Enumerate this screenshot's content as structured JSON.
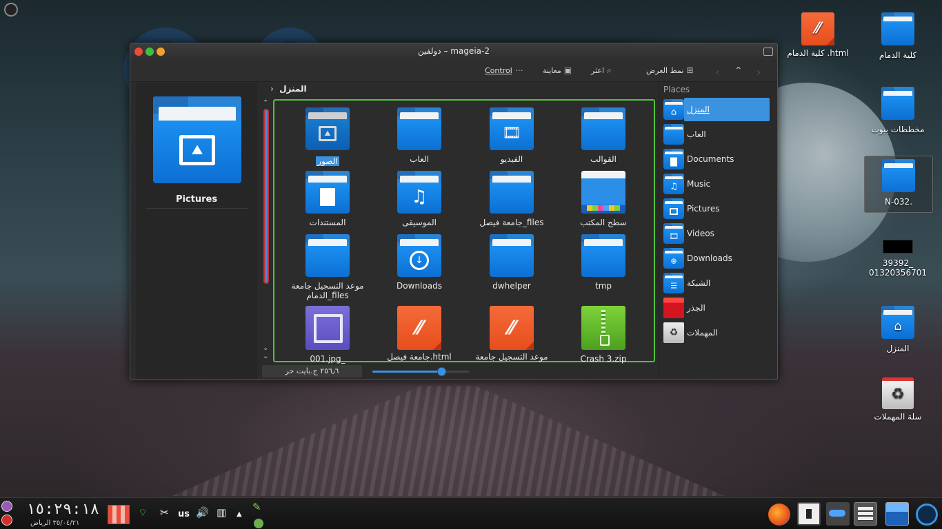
{
  "window": {
    "title": "دولفين – mageia-2"
  },
  "toolbar": {
    "control": "Control",
    "preview": "معاينة",
    "find": "اعثر",
    "view_mode": "نمط العرض"
  },
  "breadcrumb": "المنزل",
  "preview_pane": {
    "name": "Pictures"
  },
  "items": [
    {
      "label": "الصور",
      "kind": "folder-pictures",
      "selected": true
    },
    {
      "label": "العاب",
      "kind": "folder"
    },
    {
      "label": "الفيديو",
      "kind": "folder-videos"
    },
    {
      "label": "القوالب",
      "kind": "folder"
    },
    {
      "label": "المستندات",
      "kind": "folder-documents"
    },
    {
      "label": "الموسيقى",
      "kind": "folder-music"
    },
    {
      "label": "جامعة فيصل_files",
      "kind": "folder"
    },
    {
      "label": "سطح المكتب",
      "kind": "desktop"
    },
    {
      "label": "موعد التسجيل جامعة الدمام_files",
      "kind": "folder"
    },
    {
      "label": "Downloads",
      "kind": "folder-downloads"
    },
    {
      "label": "dwhelper",
      "kind": "folder"
    },
    {
      "label": "tmp",
      "kind": "folder"
    },
    {
      "label": "001.jpg_",
      "kind": "image"
    },
    {
      "label": "جامعة فيصل.html",
      "kind": "html"
    },
    {
      "label": "موعد التسجيل جامعة",
      "kind": "html"
    },
    {
      "label": "Crash 3.zip",
      "kind": "zip"
    }
  ],
  "status": {
    "free_space": "٢٥٦٫٦ ج.بايت حر",
    "zoom_level": 0.72
  },
  "places": {
    "title": "Places",
    "items": [
      {
        "label": "المنزل",
        "icon": "home",
        "active": true
      },
      {
        "label": "العاب",
        "icon": "folder"
      },
      {
        "label": "Documents",
        "icon": "documents"
      },
      {
        "label": "Music",
        "icon": "music"
      },
      {
        "label": "Pictures",
        "icon": "pictures"
      },
      {
        "label": "Videos",
        "icon": "videos"
      },
      {
        "label": "Downloads",
        "icon": "downloads"
      },
      {
        "label": "الشبكة",
        "icon": "network"
      },
      {
        "label": "الجذر",
        "icon": "root"
      },
      {
        "label": "المهملات",
        "icon": "trash"
      }
    ]
  },
  "desktop_icons": [
    {
      "label": "كلية الدمام",
      "kind": "folder"
    },
    {
      "label": "كلية الدمام .html",
      "kind": "html"
    },
    {
      "label": "مخططات بيوت",
      "kind": "folder"
    },
    {
      "label": "N-032.",
      "kind": "folder"
    },
    {
      "label": "39392_ 01320356701",
      "kind": "image-thumb"
    },
    {
      "label": "المنزل",
      "kind": "home"
    },
    {
      "label": "سلة المهملات",
      "kind": "trash"
    }
  ],
  "taskbar": {
    "clock": "١٥:٢٩:١٨",
    "date": "٣٥/٠٤/٢١ الرياض",
    "keyboard_layout": "us"
  },
  "colors": {
    "accent": "#3b93e0",
    "selection_border": "#52c43a",
    "folder_blue": "#1b8ff0",
    "html_orange": "#ef5a28",
    "zip_green": "#6cc130",
    "close_red": "#e74c3c",
    "maximize_green": "#3fbf3f",
    "minimize_orange": "#f0a030"
  }
}
